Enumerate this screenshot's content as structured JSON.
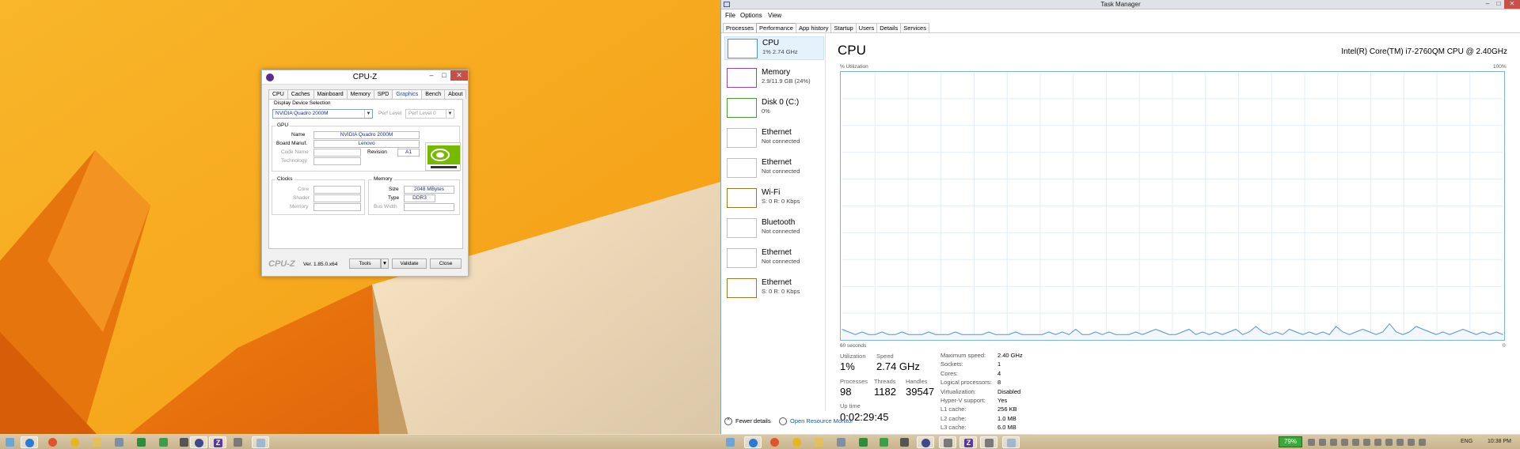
{
  "cpuz": {
    "title": "CPU-Z",
    "window_controls": {
      "minimize": "–",
      "maximize": "□",
      "close": "✕"
    },
    "tabs": [
      "CPU",
      "Caches",
      "Mainboard",
      "Memory",
      "SPD",
      "Graphics",
      "Bench",
      "About"
    ],
    "selected_tab": "Graphics",
    "display_device": {
      "group_title": "Display Device Selection",
      "selected": "NVIDIA Quadro 2000M",
      "perf_level_label": "Perf Level",
      "perf_level_value": "Perf Level 0"
    },
    "gpu": {
      "group_title": "GPU",
      "name_label": "Name",
      "name": "NVIDIA Quadro 2000M",
      "board_manuf_label": "Board Manuf.",
      "board_manuf": "Lenovo",
      "code_name_label": "Code Name",
      "code_name": "",
      "revision_label": "Revision",
      "revision": "A1",
      "technology_label": "Technology",
      "technology": ""
    },
    "clocks": {
      "group_title": "Clocks",
      "core_label": "Core",
      "shader_label": "Shader",
      "memory_label": "Memory"
    },
    "memory": {
      "group_title": "Memory",
      "size_label": "Size",
      "size": "2048 MBytes",
      "type_label": "Type",
      "type": "DDR3",
      "bus_width_label": "Bus Width",
      "bus_width": ""
    },
    "footer": {
      "logo": "CPU-Z",
      "version": "Ver. 1.85.0.x64",
      "tools_label": "Tools",
      "validate_label": "Validate",
      "close_label": "Close"
    }
  },
  "taskmgr": {
    "title": "Task Manager",
    "window_controls": {
      "minimize": "–",
      "maximize": "□",
      "close": "✕"
    },
    "menu": [
      "File",
      "Options",
      "View"
    ],
    "tabs": [
      "Processes",
      "Performance",
      "App history",
      "Startup",
      "Users",
      "Details",
      "Services"
    ],
    "selected_tab": "Performance",
    "resources": [
      {
        "name": "CPU",
        "sub": "1%  2.74 GHz",
        "color": "#4f93d6",
        "selected": true
      },
      {
        "name": "Memory",
        "sub": "2.9/11.9 GB (24%)",
        "color": "#8b46b0",
        "selected": false
      },
      {
        "name": "Disk 0 (C:)",
        "sub": "0%",
        "color": "#4a9b2f",
        "selected": false
      },
      {
        "name": "Ethernet",
        "sub": "Not connected",
        "color": "#c0c0c0",
        "selected": false
      },
      {
        "name": "Ethernet",
        "sub": "Not connected",
        "color": "#c0c0c0",
        "selected": false
      },
      {
        "name": "Wi-Fi",
        "sub": "S: 0  R: 0 Kbps",
        "color": "#9a7a2a",
        "selected": false
      },
      {
        "name": "Bluetooth",
        "sub": "Not connected",
        "color": "#c0c0c0",
        "selected": false
      },
      {
        "name": "Ethernet",
        "sub": "Not connected",
        "color": "#c0c0c0",
        "selected": false
      },
      {
        "name": "Ethernet",
        "sub": "S: 0  R: 0 Kbps",
        "color": "#9a7a2a",
        "selected": false
      }
    ],
    "cpu": {
      "title": "CPU",
      "model": "Intel(R) Core(TM) i7-2760QM CPU @ 2.40GHz",
      "graph_label": "% Utilization",
      "graph_max": "100%",
      "graph_time": "60 seconds",
      "graph_min": "0",
      "utilization_label": "Utilization",
      "utilization": "1%",
      "speed_label": "Speed",
      "speed": "2.74 GHz",
      "processes_label": "Processes",
      "processes": "98",
      "threads_label": "Threads",
      "threads": "1182",
      "handles_label": "Handles",
      "handles": "39547",
      "uptime_label": "Up time",
      "uptime": "0:02:29:45",
      "specs": [
        {
          "key": "Maximum speed:",
          "value": "2.40 GHz"
        },
        {
          "key": "Sockets:",
          "value": "1"
        },
        {
          "key": "Cores:",
          "value": "4"
        },
        {
          "key": "Logical processors:",
          "value": "8"
        },
        {
          "key": "Virtualization:",
          "value": "Disabled"
        },
        {
          "key": "Hyper-V support:",
          "value": "Yes"
        },
        {
          "key": "L1 cache:",
          "value": "256 KB"
        },
        {
          "key": "L2 cache:",
          "value": "1.0 MB"
        },
        {
          "key": "L3 cache:",
          "value": "6.0 MB"
        }
      ]
    },
    "footer": {
      "fewer_details": "Fewer details",
      "open_resource_monitor": "Open Resource Monitor"
    }
  },
  "cpu_usage_series": [
    4,
    3,
    2,
    3,
    2,
    2,
    3,
    2,
    2,
    3,
    2,
    2,
    2,
    3,
    2,
    2,
    2,
    3,
    2,
    2,
    2,
    2,
    3,
    2,
    2,
    2,
    3,
    2,
    2,
    2,
    2,
    3,
    2,
    3,
    2,
    4,
    2,
    2,
    3,
    2,
    3,
    2,
    2,
    2,
    3,
    2,
    3,
    4,
    3,
    2,
    2,
    3,
    4,
    2,
    3,
    2,
    3,
    2,
    3,
    4,
    2,
    3,
    5,
    3,
    2,
    3,
    2,
    4,
    3,
    2,
    3,
    2,
    3,
    2,
    5,
    3,
    2,
    3,
    4,
    3,
    2,
    3,
    6,
    3,
    2,
    3,
    5,
    4,
    3,
    2,
    3,
    2,
    3,
    4,
    3,
    2,
    3,
    2,
    3,
    2
  ],
  "taskbar": {
    "battery": "79%",
    "language": "ENG",
    "clock": "10:38 PM"
  },
  "colors": {
    "wallpaper_orange": "#f7a51a",
    "cpu_accent": "#4f93d6",
    "battery_green": "#3ba83b",
    "close_red": "#c7504b"
  }
}
